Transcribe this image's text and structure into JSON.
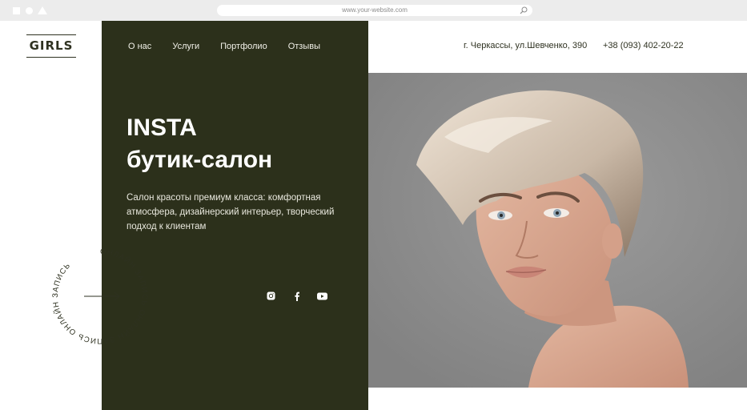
{
  "browser": {
    "url": "www.your-website.com",
    "search_icon": "magnifier-icon"
  },
  "logo": {
    "text": "GIRLS"
  },
  "nav": {
    "items": [
      "О нас",
      "Услуги",
      "Портфолио",
      "Отзывы"
    ]
  },
  "header": {
    "address": "г. Черкассы, ул.Шевченко, 390",
    "phone": "+38 (093) 402-20-22"
  },
  "hero": {
    "title_line1": "INSTA",
    "title_line2": "бутик-салон",
    "description": "Салон красоты премиум класса: комфортная атмосфера, дизайнерский интерьер, творческий подход к клиентам"
  },
  "badge": {
    "ring_text": "ОНЛАЙН ЗАПИСЬ ОНЛАЙН ЗАПИСЬ ОНЛАЙН ЗАПИСЬ"
  },
  "socials": [
    "instagram-icon",
    "facebook-icon",
    "youtube-icon"
  ],
  "colors": {
    "panel": "#2c301b",
    "text_dark": "#2e3120",
    "photo_bg": "#8f8f8f"
  }
}
